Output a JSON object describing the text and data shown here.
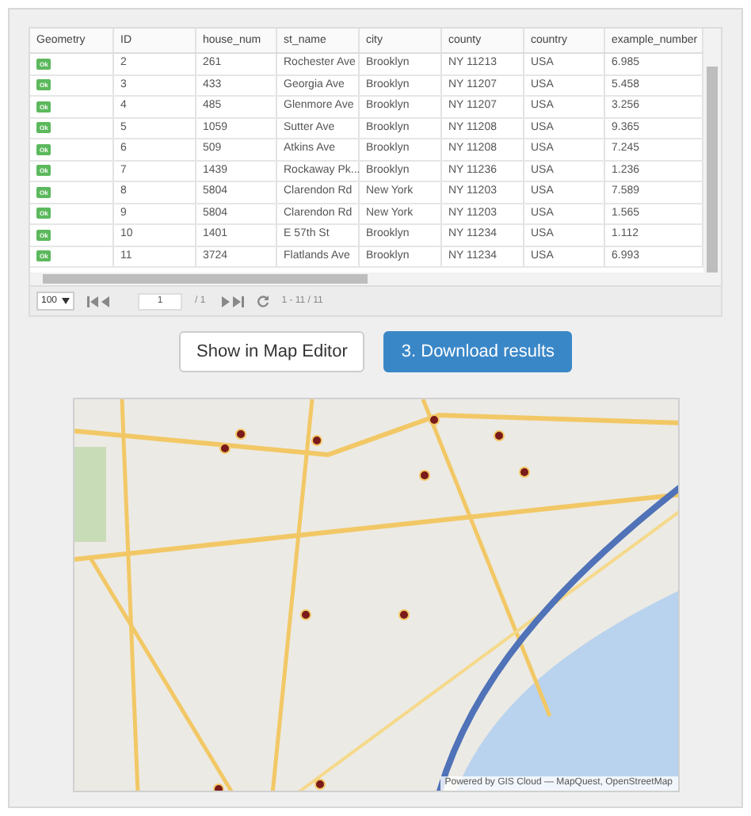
{
  "table": {
    "columns": [
      "Geometry",
      "ID",
      "house_num",
      "st_name",
      "city",
      "county",
      "country",
      "example_number"
    ],
    "rows": [
      {
        "cells": [
          "Ok",
          "2",
          "261",
          "Rochester Ave",
          "Brooklyn",
          "NY 11213",
          "USA",
          "6.985"
        ]
      },
      {
        "cells": [
          "Ok",
          "3",
          "433",
          "Georgia Ave",
          "Brooklyn",
          "NY 11207",
          "USA",
          "5.458"
        ]
      },
      {
        "cells": [
          "Ok",
          "4",
          "485",
          "Glenmore Ave",
          "Brooklyn",
          "NY 11207",
          "USA",
          "3.256"
        ]
      },
      {
        "cells": [
          "Ok",
          "5",
          "1059",
          "Sutter Ave",
          "Brooklyn",
          "NY 11208",
          "USA",
          "9.365"
        ]
      },
      {
        "cells": [
          "Ok",
          "6",
          "509",
          "Atkins Ave",
          "Brooklyn",
          "NY 11208",
          "USA",
          "7.245"
        ]
      },
      {
        "cells": [
          "Ok",
          "7",
          "1439",
          "Rockaway Pk...",
          "Brooklyn",
          "NY 11236",
          "USA",
          "1.236"
        ]
      },
      {
        "cells": [
          "Ok",
          "8",
          "5804",
          "Clarendon Rd",
          "New York",
          "NY 11203",
          "USA",
          "7.589"
        ]
      },
      {
        "cells": [
          "Ok",
          "9",
          "5804",
          "Clarendon Rd",
          "New York",
          "NY 11203",
          "USA",
          "1.565"
        ]
      },
      {
        "cells": [
          "Ok",
          "10",
          "1401",
          "E 57th St",
          "Brooklyn",
          "NY 11234",
          "USA",
          "1.112"
        ]
      },
      {
        "cells": [
          "Ok",
          "11",
          "3724",
          "Flatlands Ave",
          "Brooklyn",
          "NY 11234",
          "USA",
          "6.993"
        ]
      }
    ]
  },
  "pager": {
    "page_size": "100",
    "page": "1",
    "page_total": "/ 1",
    "range": "1 - 11 / 11"
  },
  "buttons": [
    {
      "label": "Show in Map Editor",
      "kind": "secondary"
    },
    {
      "label": "3. Download results",
      "kind": "primary"
    }
  ],
  "map": {
    "attribution": "Powered by GIS Cloud — MapQuest, OpenStreetMap"
  }
}
